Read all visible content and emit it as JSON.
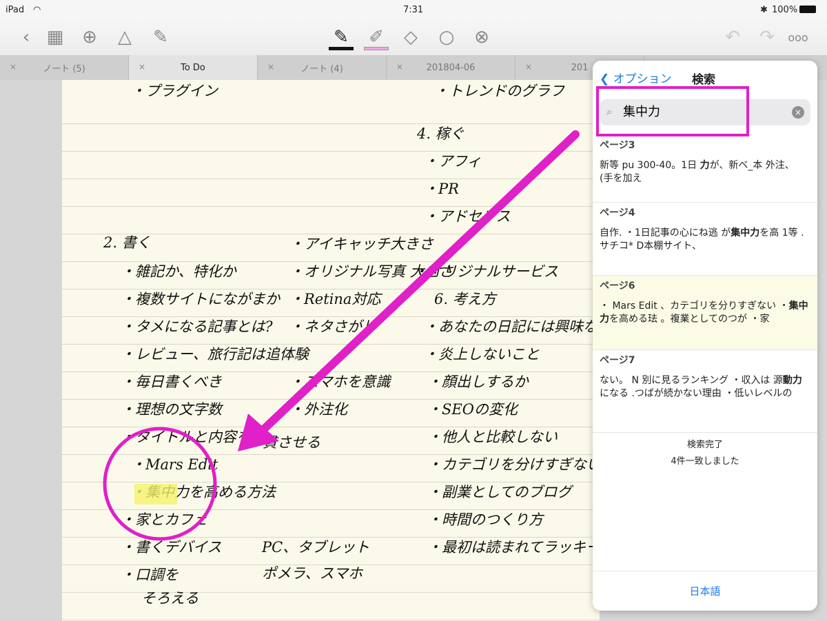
{
  "status": {
    "device": "iPad",
    "time": "7:31",
    "battery": "100%"
  },
  "toolbar": {
    "icons": [
      "back-chevron",
      "grid",
      "add-page",
      "shapes",
      "edit",
      "pen",
      "highlighter",
      "eraser",
      "lasso",
      "no-tool",
      "undo",
      "redo",
      "more"
    ],
    "pen_color": "#111111",
    "highlighter_color": "#f0a8e0"
  },
  "tabs": [
    {
      "label": "ノート (5)"
    },
    {
      "label": "To Do",
      "active": true
    },
    {
      "label": "ノート (4)"
    },
    {
      "label": "201804-06"
    },
    {
      "label": "201"
    }
  ],
  "note": {
    "lines": [
      "・プラグイン",
      "2. 書く",
      "・雑記か、特化か",
      "・複数サイトにながまか",
      "・タメになる記事とは?",
      "・レビュー、旅行記は追体験",
      "・毎日書くべき",
      "・理想の文字数",
      "・タイトルと内容を",
      "・Mars Edit",
      "・集中力を高める方法",
      "・家とカフェ",
      "・書くデバイス",
      "・口調を",
      "そろえる",
      "・アイキャッチ大きさ",
      "・オリジナル写真 大きさ",
      "・Retina対応",
      "・ネタさがし",
      "・スマホを意識",
      "・外注化",
      "一貫させる",
      "PC、タブレット",
      "ポメラ、スマホ",
      "・トレンドのグラフ",
      "4. 稼ぐ",
      "・アフィ",
      "・PR",
      "・アドセンス",
      "・オリジナルサービス",
      "6. 考え方",
      "・あなたの日記には興味なし",
      "・炎上しないこと",
      "・顔出しするか",
      "・SEOの変化",
      "・他人と比較しない",
      "・カテゴリを分けすぎない",
      "・副業としてのブログ",
      "・時間のつくり方",
      "・最初は読まれてラッキー"
    ],
    "highlight_color": "#f4f36a",
    "annotation_color": "#e020c8"
  },
  "search": {
    "back_label": "オプション",
    "title": "検索",
    "query": "集中力",
    "results": [
      {
        "page": "ページ3",
        "pre": "新等 pu 300-40。1日 ",
        "match": "力",
        "post": "が、新べ_本 外注、 (手を加え"
      },
      {
        "page": "ページ4",
        "pre": "自作. ・1日記事の心にね逃 が",
        "match": "集中力",
        "post": "を高 1等 .サチコ* D本棚サイト、"
      },
      {
        "page": "ページ6",
        "pre": "・ Mars Edit 、カテゴリを分りすぎない ・",
        "match": "集中力",
        "post": "を高める珐 。複業としてのつが ・家",
        "highlighted": true
      },
      {
        "page": "ページ7",
        "pre": "ない。 N 別に見るランキング ・収入は 源",
        "match": "動力",
        "post": "になる .つばが続かない理由 ・低いレベルの"
      }
    ],
    "status": "検索完了",
    "count": "4件一致しました",
    "language": "日本語"
  }
}
